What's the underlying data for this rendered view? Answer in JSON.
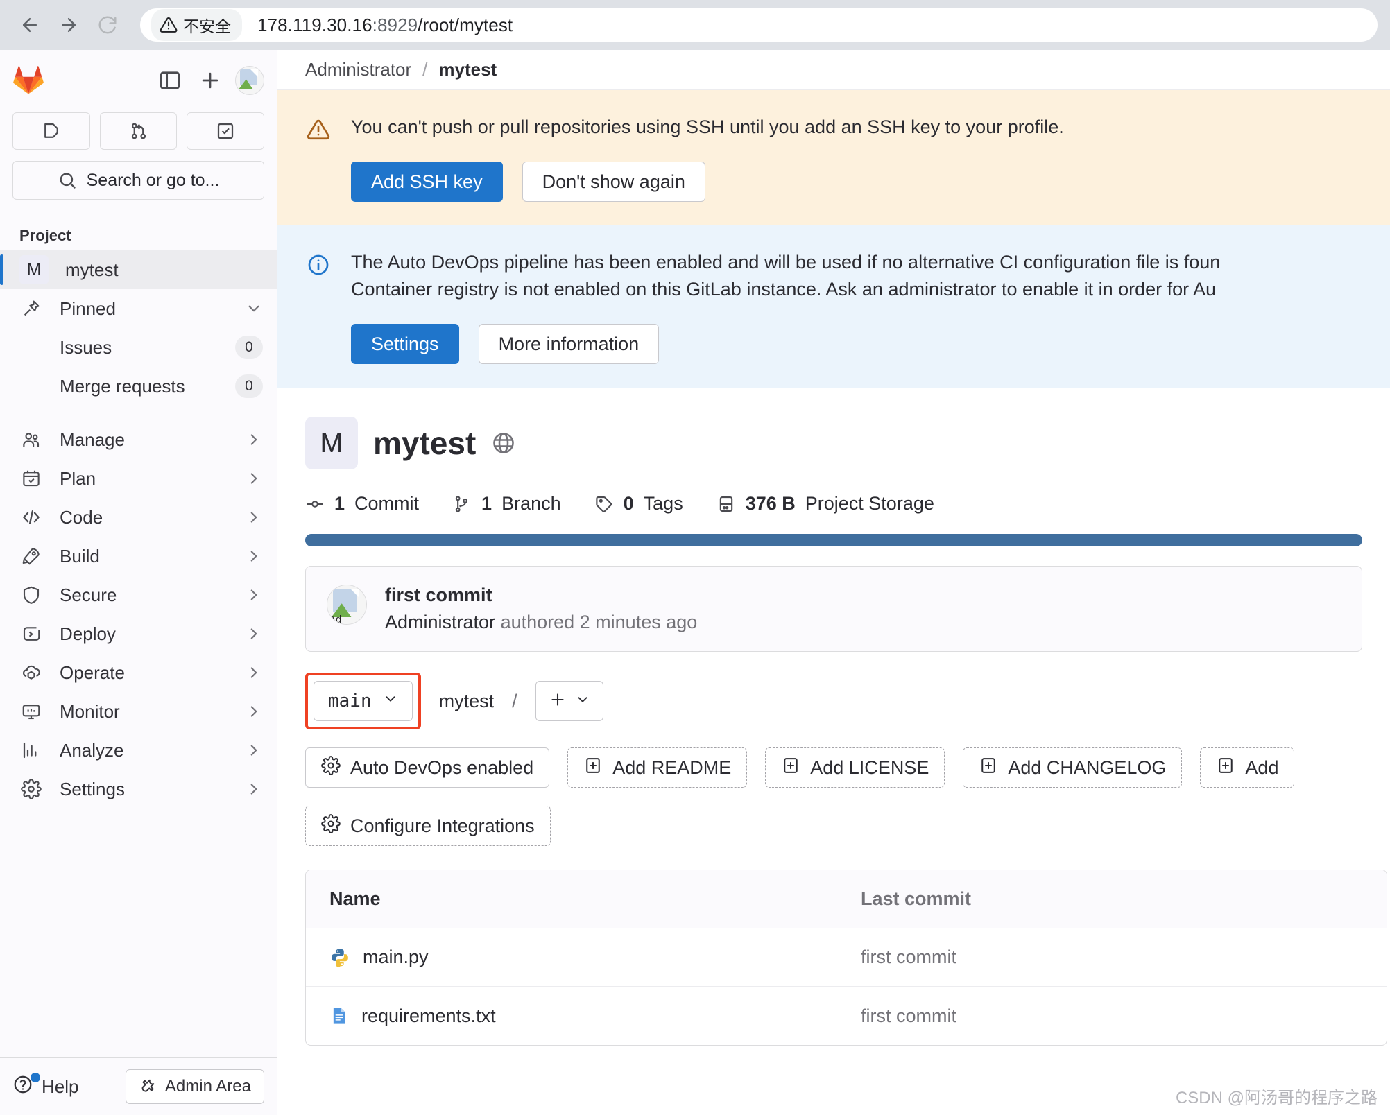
{
  "browser": {
    "back_icon": "arrow-left-icon",
    "forward_icon": "arrow-right-icon",
    "reload_icon": "reload-icon",
    "security_label": "不安全",
    "url_host": "178.119.30.16",
    "url_port": ":8929",
    "url_path": "/root/mytest"
  },
  "sidebar": {
    "logo": "gitlab-logo",
    "toggle_icon": "sidebar-toggle-icon",
    "new_icon": "plus-icon",
    "avatar": "user-avatar",
    "quick_actions": [
      {
        "name": "issues-quick",
        "icon": "issue-icon"
      },
      {
        "name": "merge-requests-quick",
        "icon": "merge-request-icon"
      },
      {
        "name": "todos-quick",
        "icon": "todo-check-icon"
      }
    ],
    "search_placeholder": "Search or go to...",
    "search_icon": "search-icon",
    "section_title": "Project",
    "project": {
      "initial": "M",
      "name": "mytest"
    },
    "pinned": {
      "label": "Pinned",
      "icon": "pin-icon"
    },
    "pinned_items": [
      {
        "label": "Issues",
        "count": "0"
      },
      {
        "label": "Merge requests",
        "count": "0"
      }
    ],
    "nav": [
      {
        "label": "Manage",
        "icon": "users-icon"
      },
      {
        "label": "Plan",
        "icon": "calendar-icon"
      },
      {
        "label": "Code",
        "icon": "code-icon"
      },
      {
        "label": "Build",
        "icon": "rocket-icon"
      },
      {
        "label": "Secure",
        "icon": "shield-icon"
      },
      {
        "label": "Deploy",
        "icon": "deploy-icon"
      },
      {
        "label": "Operate",
        "icon": "cloud-cube-icon"
      },
      {
        "label": "Monitor",
        "icon": "monitor-icon"
      },
      {
        "label": "Analyze",
        "icon": "chart-icon"
      },
      {
        "label": "Settings",
        "icon": "gear-icon"
      }
    ],
    "help_label": "Help",
    "help_icon": "question-icon",
    "admin_label": "Admin Area",
    "admin_icon": "wrench-icon"
  },
  "breadcrumb": {
    "parent": "Administrator",
    "separator": "/",
    "current": "mytest"
  },
  "alerts": [
    {
      "type": "warning",
      "icon": "warning-triangle-icon",
      "text": "You can't push or pull repositories using SSH until you add an SSH key to your profile.",
      "primary": "Add SSH key",
      "secondary": "Don't show again"
    },
    {
      "type": "info",
      "icon": "info-circle-icon",
      "line1": "The Auto DevOps pipeline has been enabled and will be used if no alternative CI configuration file is foun",
      "line2": "Container registry is not enabled on this GitLab instance. Ask an administrator to enable it in order for Au",
      "primary": "Settings",
      "secondary": "More information"
    }
  ],
  "project": {
    "initial": "M",
    "name": "mytest",
    "visibility_icon": "globe-icon",
    "stats": [
      {
        "icon": "commit-icon",
        "value": "1",
        "label": "Commit"
      },
      {
        "icon": "branch-icon",
        "value": "1",
        "label": "Branch"
      },
      {
        "icon": "tag-icon",
        "value": "0",
        "label": "Tags"
      },
      {
        "icon": "storage-icon",
        "value": "376 B",
        "label": "Project Storage"
      }
    ],
    "language_bar_color": "#3f6e9e"
  },
  "commit": {
    "title": "first commit",
    "author": "Administrator",
    "meta": "authored 2 minutes ago",
    "avatar_alt": "Ad"
  },
  "branch_row": {
    "branch": "main",
    "chevron_icon": "chevron-down-icon",
    "path": "mytest",
    "path_separator": "/",
    "add_icon": "plus-icon",
    "highlight_color": "#ef4123"
  },
  "quick_setup": [
    {
      "label": "Auto DevOps enabled",
      "icon": "gear-icon",
      "style": "solid"
    },
    {
      "label": "Add README",
      "icon": "plus-square-icon",
      "style": "dashed"
    },
    {
      "label": "Add LICENSE",
      "icon": "plus-square-icon",
      "style": "dashed"
    },
    {
      "label": "Add CHANGELOG",
      "icon": "plus-square-icon",
      "style": "dashed"
    },
    {
      "label": "Add",
      "icon": "plus-square-icon",
      "style": "dashed"
    },
    {
      "label": "Configure Integrations",
      "icon": "gear-icon",
      "style": "dashed"
    }
  ],
  "file_table": {
    "columns": {
      "name": "Name",
      "last_commit": "Last commit"
    },
    "rows": [
      {
        "name": "main.py",
        "icon": "python-file-icon",
        "last_commit": "first commit"
      },
      {
        "name": "requirements.txt",
        "icon": "text-file-icon",
        "last_commit": "first commit"
      }
    ]
  },
  "watermark": "CSDN @阿汤哥的程序之路"
}
